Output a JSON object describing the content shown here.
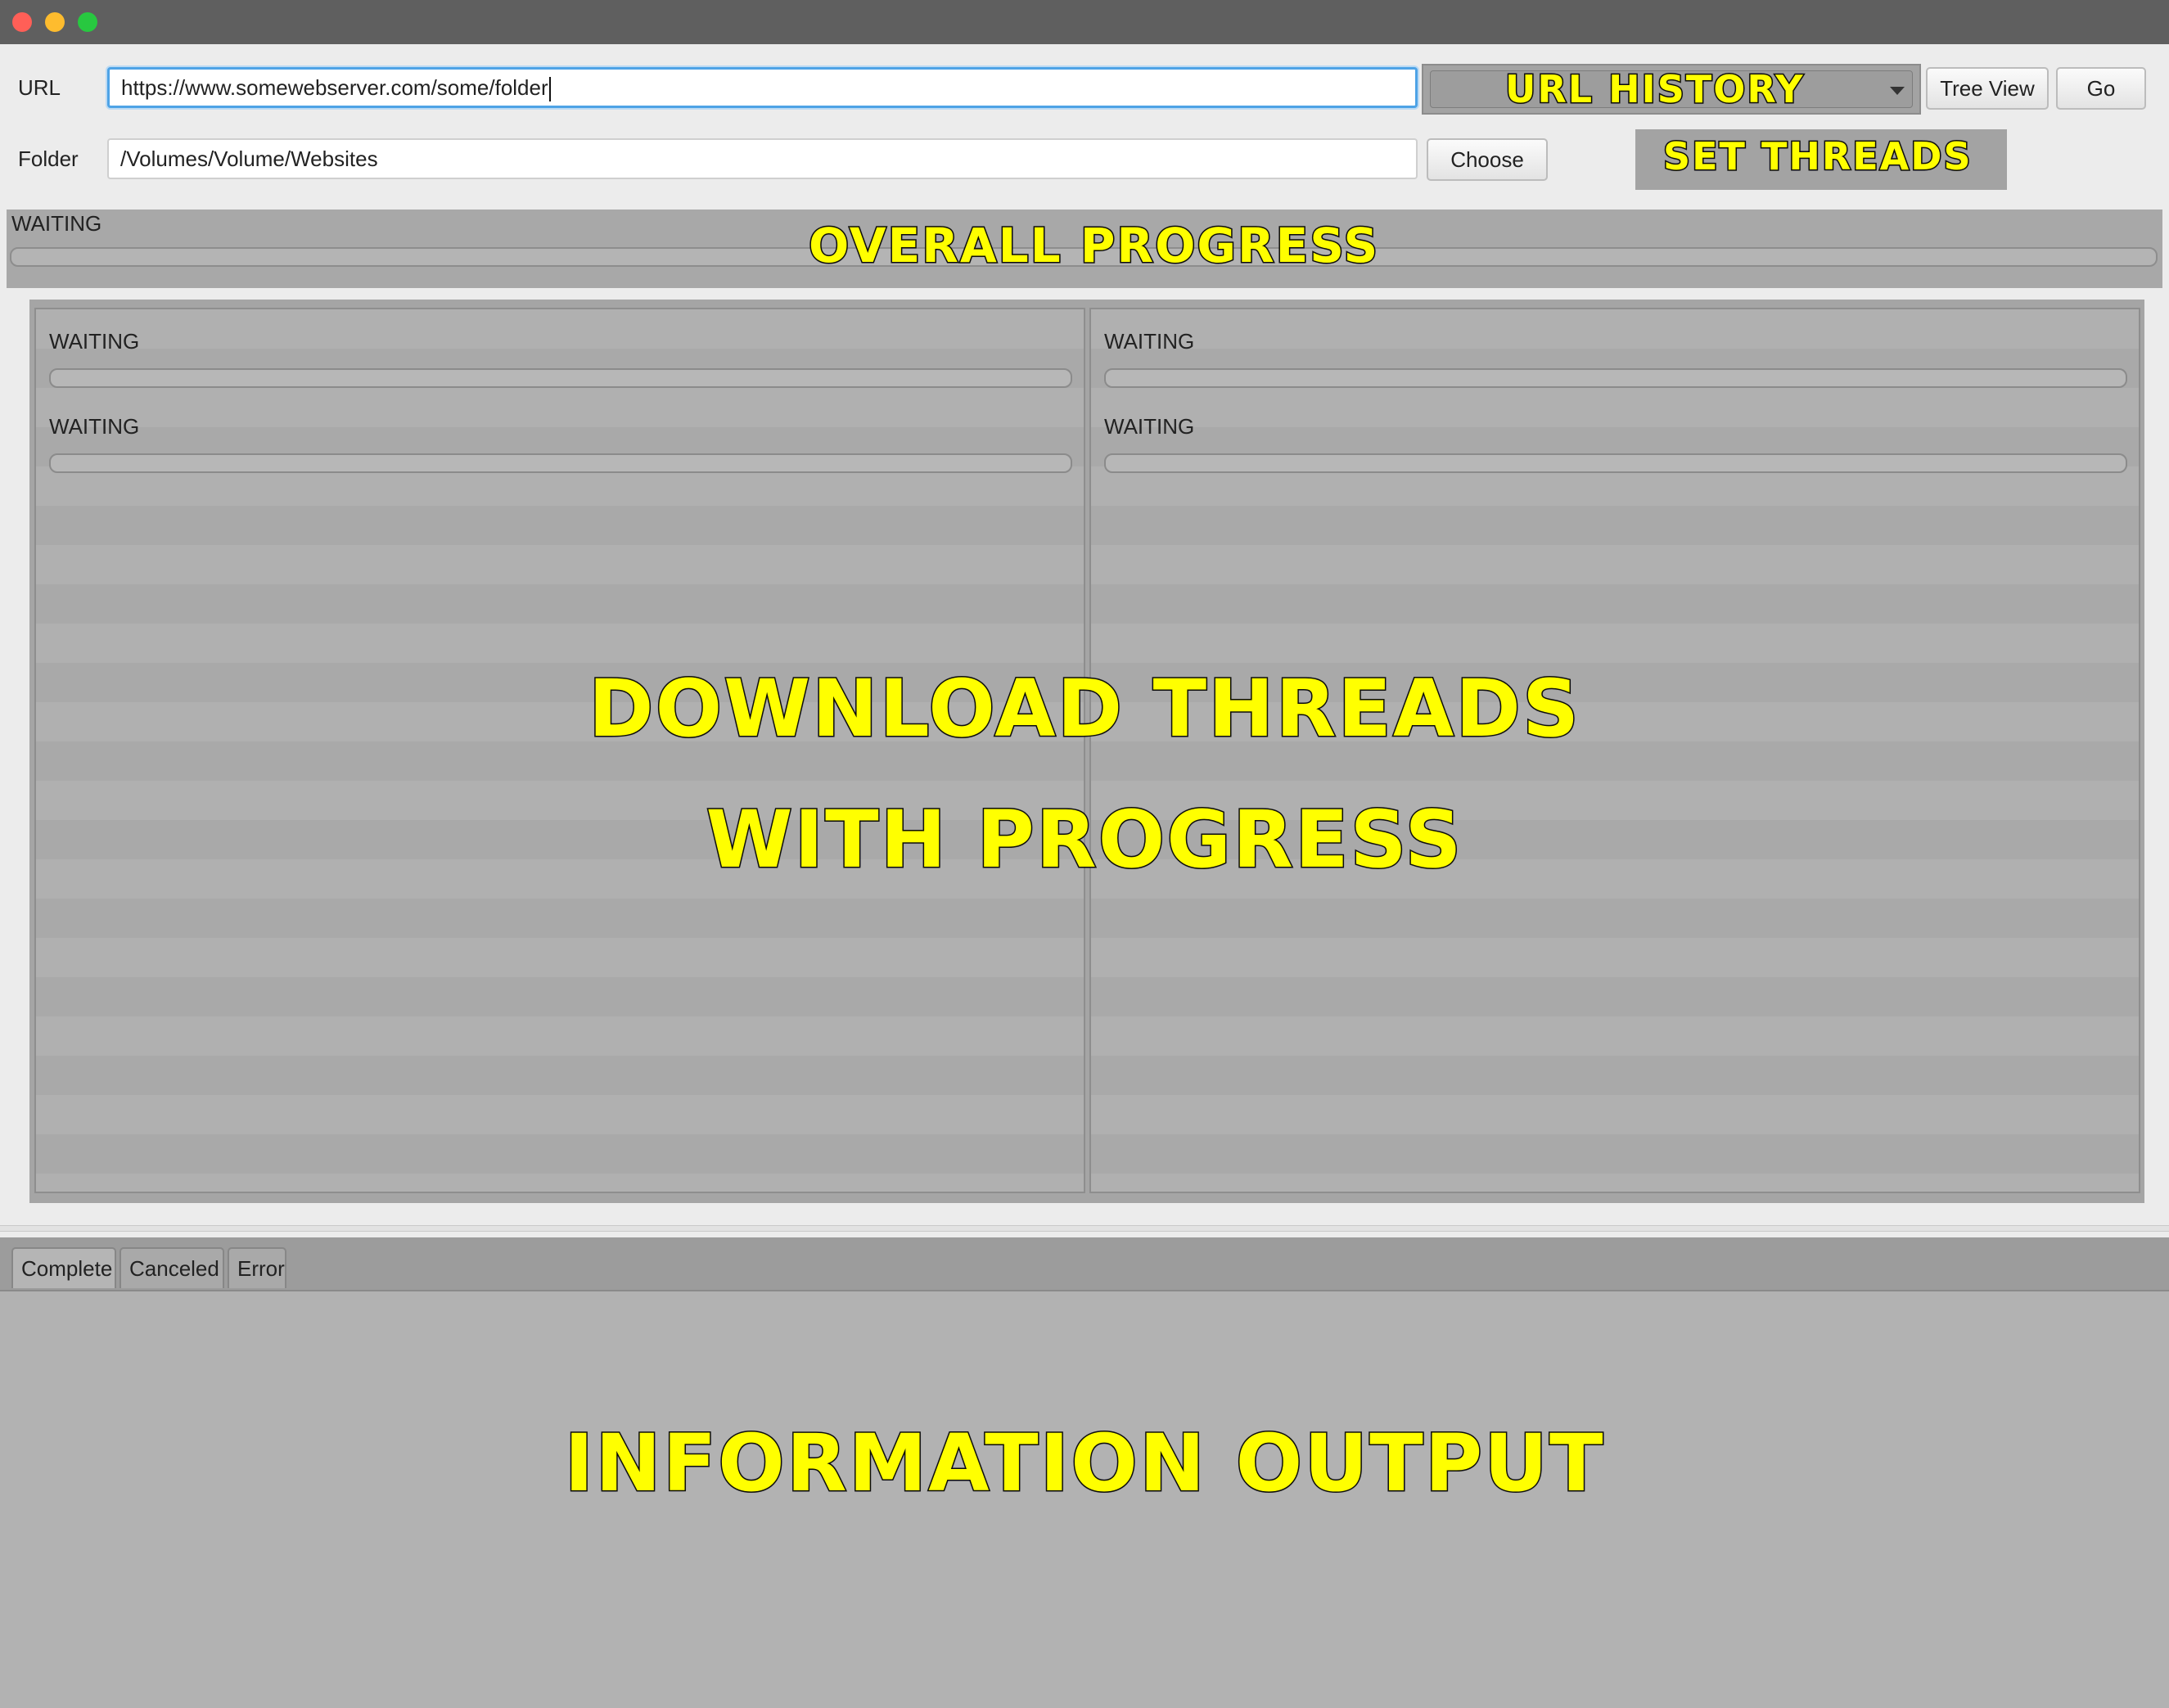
{
  "window": {
    "controls": [
      "close",
      "minimize",
      "maximize"
    ]
  },
  "form": {
    "url_label": "URL",
    "url_value": "https://www.somewebserver.com/some/folder",
    "folder_label": "Folder",
    "folder_value": "/Volumes/Volume/Websites",
    "choose_label": "Choose",
    "tree_view_label": "Tree View",
    "go_label": "Go"
  },
  "annotations": {
    "url_history": "URL HISTORY",
    "set_threads": "SET THREADS",
    "overall_progress": "OVERALL PROGRESS",
    "download_threads_line1": "DOWNLOAD THREADS",
    "download_threads_line2": "WITH PROGRESS",
    "information_output": "INFORMATION OUTPUT"
  },
  "overall": {
    "status": "WAITING",
    "progress": 0
  },
  "threads": {
    "left": [
      {
        "status": "WAITING",
        "progress": 0
      },
      {
        "status": "WAITING",
        "progress": 0
      }
    ],
    "right": [
      {
        "status": "WAITING",
        "progress": 0
      },
      {
        "status": "WAITING",
        "progress": 0
      }
    ]
  },
  "info_tabs": [
    {
      "label": "Complete",
      "active": true
    },
    {
      "label": "Canceled",
      "active": false
    },
    {
      "label": "Error",
      "active": false
    }
  ],
  "colors": {
    "accent": "#4ea3e6",
    "annotation_text": "#ffff00",
    "titlebar": "#5f5f5f"
  },
  "icons": [
    "chevron-down-icon"
  ]
}
